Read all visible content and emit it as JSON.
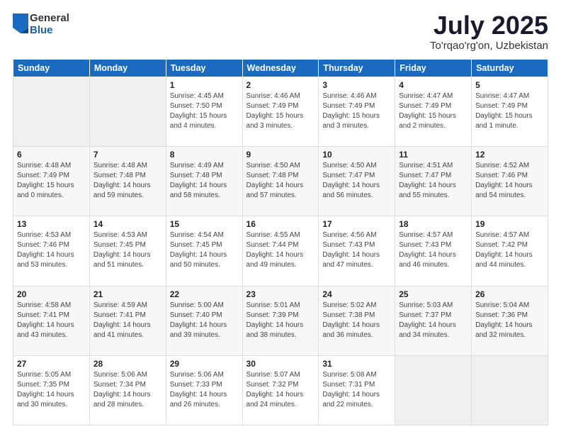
{
  "logo": {
    "general": "General",
    "blue": "Blue"
  },
  "title": "July 2025",
  "location": "To'rqao'rg'on, Uzbekistan",
  "weekdays": [
    "Sunday",
    "Monday",
    "Tuesday",
    "Wednesday",
    "Thursday",
    "Friday",
    "Saturday"
  ],
  "weeks": [
    [
      {
        "day": "",
        "info": ""
      },
      {
        "day": "",
        "info": ""
      },
      {
        "day": "1",
        "info": "Sunrise: 4:45 AM\nSunset: 7:50 PM\nDaylight: 15 hours\nand 4 minutes."
      },
      {
        "day": "2",
        "info": "Sunrise: 4:46 AM\nSunset: 7:49 PM\nDaylight: 15 hours\nand 3 minutes."
      },
      {
        "day": "3",
        "info": "Sunrise: 4:46 AM\nSunset: 7:49 PM\nDaylight: 15 hours\nand 3 minutes."
      },
      {
        "day": "4",
        "info": "Sunrise: 4:47 AM\nSunset: 7:49 PM\nDaylight: 15 hours\nand 2 minutes."
      },
      {
        "day": "5",
        "info": "Sunrise: 4:47 AM\nSunset: 7:49 PM\nDaylight: 15 hours\nand 1 minute."
      }
    ],
    [
      {
        "day": "6",
        "info": "Sunrise: 4:48 AM\nSunset: 7:49 PM\nDaylight: 15 hours\nand 0 minutes."
      },
      {
        "day": "7",
        "info": "Sunrise: 4:48 AM\nSunset: 7:48 PM\nDaylight: 14 hours\nand 59 minutes."
      },
      {
        "day": "8",
        "info": "Sunrise: 4:49 AM\nSunset: 7:48 PM\nDaylight: 14 hours\nand 58 minutes."
      },
      {
        "day": "9",
        "info": "Sunrise: 4:50 AM\nSunset: 7:48 PM\nDaylight: 14 hours\nand 57 minutes."
      },
      {
        "day": "10",
        "info": "Sunrise: 4:50 AM\nSunset: 7:47 PM\nDaylight: 14 hours\nand 56 minutes."
      },
      {
        "day": "11",
        "info": "Sunrise: 4:51 AM\nSunset: 7:47 PM\nDaylight: 14 hours\nand 55 minutes."
      },
      {
        "day": "12",
        "info": "Sunrise: 4:52 AM\nSunset: 7:46 PM\nDaylight: 14 hours\nand 54 minutes."
      }
    ],
    [
      {
        "day": "13",
        "info": "Sunrise: 4:53 AM\nSunset: 7:46 PM\nDaylight: 14 hours\nand 53 minutes."
      },
      {
        "day": "14",
        "info": "Sunrise: 4:53 AM\nSunset: 7:45 PM\nDaylight: 14 hours\nand 51 minutes."
      },
      {
        "day": "15",
        "info": "Sunrise: 4:54 AM\nSunset: 7:45 PM\nDaylight: 14 hours\nand 50 minutes."
      },
      {
        "day": "16",
        "info": "Sunrise: 4:55 AM\nSunset: 7:44 PM\nDaylight: 14 hours\nand 49 minutes."
      },
      {
        "day": "17",
        "info": "Sunrise: 4:56 AM\nSunset: 7:43 PM\nDaylight: 14 hours\nand 47 minutes."
      },
      {
        "day": "18",
        "info": "Sunrise: 4:57 AM\nSunset: 7:43 PM\nDaylight: 14 hours\nand 46 minutes."
      },
      {
        "day": "19",
        "info": "Sunrise: 4:57 AM\nSunset: 7:42 PM\nDaylight: 14 hours\nand 44 minutes."
      }
    ],
    [
      {
        "day": "20",
        "info": "Sunrise: 4:58 AM\nSunset: 7:41 PM\nDaylight: 14 hours\nand 43 minutes."
      },
      {
        "day": "21",
        "info": "Sunrise: 4:59 AM\nSunset: 7:41 PM\nDaylight: 14 hours\nand 41 minutes."
      },
      {
        "day": "22",
        "info": "Sunrise: 5:00 AM\nSunset: 7:40 PM\nDaylight: 14 hours\nand 39 minutes."
      },
      {
        "day": "23",
        "info": "Sunrise: 5:01 AM\nSunset: 7:39 PM\nDaylight: 14 hours\nand 38 minutes."
      },
      {
        "day": "24",
        "info": "Sunrise: 5:02 AM\nSunset: 7:38 PM\nDaylight: 14 hours\nand 36 minutes."
      },
      {
        "day": "25",
        "info": "Sunrise: 5:03 AM\nSunset: 7:37 PM\nDaylight: 14 hours\nand 34 minutes."
      },
      {
        "day": "26",
        "info": "Sunrise: 5:04 AM\nSunset: 7:36 PM\nDaylight: 14 hours\nand 32 minutes."
      }
    ],
    [
      {
        "day": "27",
        "info": "Sunrise: 5:05 AM\nSunset: 7:35 PM\nDaylight: 14 hours\nand 30 minutes."
      },
      {
        "day": "28",
        "info": "Sunrise: 5:06 AM\nSunset: 7:34 PM\nDaylight: 14 hours\nand 28 minutes."
      },
      {
        "day": "29",
        "info": "Sunrise: 5:06 AM\nSunset: 7:33 PM\nDaylight: 14 hours\nand 26 minutes."
      },
      {
        "day": "30",
        "info": "Sunrise: 5:07 AM\nSunset: 7:32 PM\nDaylight: 14 hours\nand 24 minutes."
      },
      {
        "day": "31",
        "info": "Sunrise: 5:08 AM\nSunset: 7:31 PM\nDaylight: 14 hours\nand 22 minutes."
      },
      {
        "day": "",
        "info": ""
      },
      {
        "day": "",
        "info": ""
      }
    ]
  ]
}
